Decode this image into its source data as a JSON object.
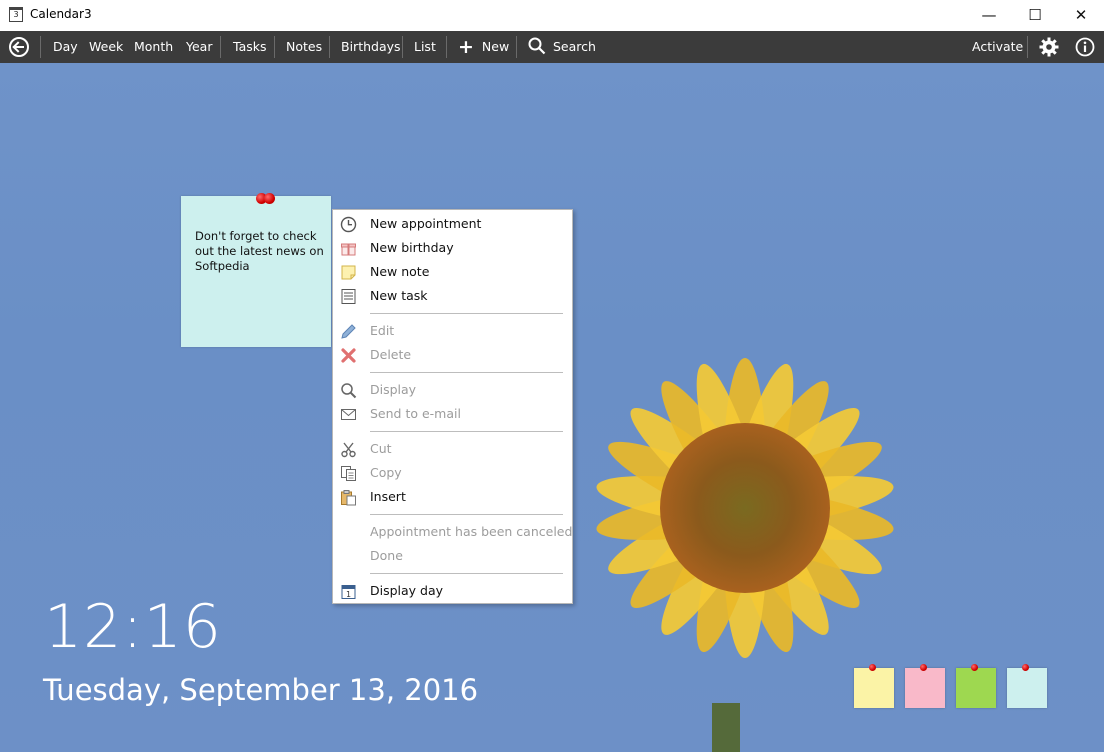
{
  "window": {
    "title": "Calendar3",
    "app_icon_text": "3",
    "controls": {
      "minimize": "—",
      "maximize": "☐",
      "close": "✕"
    }
  },
  "toolbar": {
    "items": [
      "Day",
      "Week",
      "Month",
      "Year",
      "Tasks",
      "Notes",
      "Birthdays",
      "List"
    ],
    "new_label": "New",
    "search_label": "Search",
    "activate_label": "Activate"
  },
  "note": {
    "text": "Don't forget to check out the latest news on Softpedia",
    "color": "#cdf0ee"
  },
  "context_menu": {
    "new_appointment": "New appointment",
    "new_birthday": "New birthday",
    "new_note": "New note",
    "new_task": "New task",
    "edit": "Edit",
    "delete": "Delete",
    "display": "Display",
    "send_email": "Send to e-mail",
    "cut": "Cut",
    "copy": "Copy",
    "insert": "Insert",
    "appointment_canceled": "Appointment has been canceled",
    "done": "Done",
    "display_day": "Display day"
  },
  "clock": {
    "time": "12:16",
    "date": "Tuesday, September 13, 2016"
  },
  "mini_notes": [
    "#fbf3a6",
    "#f9b9c9",
    "#9ed850",
    "#cdf0ee"
  ]
}
